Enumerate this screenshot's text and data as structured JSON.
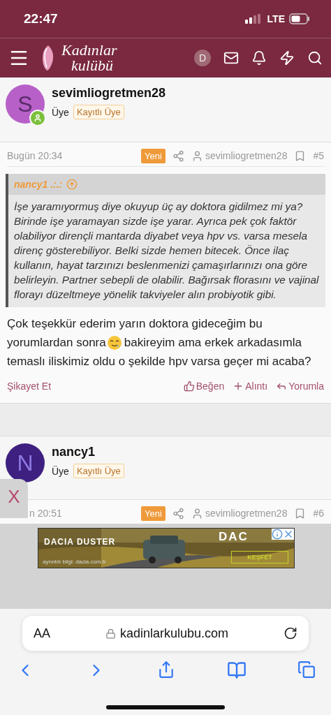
{
  "status_bar": {
    "time": "22:47",
    "network": "LTE"
  },
  "nav": {
    "logo_top": "Kadınlar",
    "logo_bottom": "kulübü",
    "avatar_letter": "D"
  },
  "posts": [
    {
      "avatar_letter": "S",
      "color": "#b760c8",
      "author": "sevimliogretmen28",
      "role": "Üye",
      "badge": "Kayıtlı Üye",
      "online": true,
      "date": "Bugün 20:34",
      "new_badge": "Yeni",
      "post_author": "sevimliogretmen28",
      "number": "#5",
      "quote": {
        "author": "nancy1 .:.:",
        "text": "İşe yaramıyormuş diye okuyup üç ay doktora gidilmez mi ya? Birinde işe yaramayan sizde işe yarar. Ayrıca pek çok faktör olabiliyor dirençli mantarda diyabet veya hpv vs. varsa mesela direnç gösterebiliyor. Belki sizde hemen bitecek. Önce ilaç kullanın, hayat tarzınızı beslenmenizi çamaşırlarınızı ona göre belirleyin. Partner sebepli de olabilir. Bağırsak florasını ve vajinal florayı düzeltmeye yönelik takviyeler alın probiyotik gibi."
      },
      "body": [
        "Çok teşekkür ederim yarın doktora gideceğim bu",
        "yorumlardan sonra",
        "bakireyim ama erkek arkadasımla",
        "temaslı iliskimiz oldu o şekilde hpv varsa geçer mi acaba?"
      ],
      "actions": {
        "report": "Şikayet Et",
        "like": "Beğen",
        "quote": "Alıntı",
        "reply": "Yorumla"
      }
    },
    {
      "avatar_letter": "N",
      "color": "#3d2080",
      "author": "nancy1",
      "role": "Üye",
      "badge": "Kayıtlı Üye",
      "online": false,
      "date": "n 20:51",
      "new_badge": "Yeni",
      "post_author": "sevimliogretmen28",
      "number": "#6"
    }
  ],
  "ad": {
    "close_tab": "X",
    "headline": "DACIA DUSTER",
    "logo": "DAC",
    "cta": "KEŞFET",
    "disclaimer": "ayrıntılı bilgi: dacia.com.tr"
  },
  "browser": {
    "text_size": "AA",
    "url": "kadinlarkulubu.com"
  }
}
